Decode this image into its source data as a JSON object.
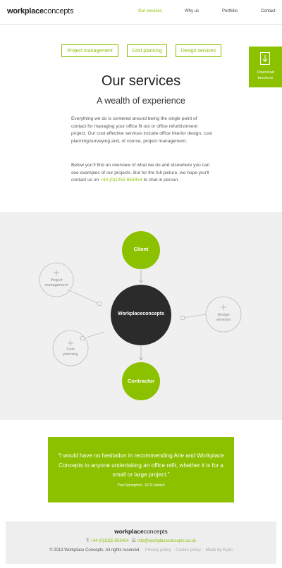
{
  "header": {
    "logo_bold": "workplace",
    "logo_light": "concepts",
    "nav": [
      {
        "label": "Our services",
        "active": true
      },
      {
        "label": "Why us",
        "active": false
      },
      {
        "label": "Portfolio",
        "active": false
      },
      {
        "label": "Contact",
        "active": false
      }
    ]
  },
  "tabs": [
    "Project management",
    "Cost planning",
    "Design services"
  ],
  "download": {
    "line1": "Download",
    "line2": "brochure",
    "icon": "download-arrow-icon"
  },
  "intro": {
    "title": "Our services",
    "subtitle": "A wealth of experience",
    "p1": "Everything we do is centered around being the single point of contact for managing your office fit out or office refurbishment project. Our cost effective services include office interior design, cost planning/surveying and, of course, project management.",
    "p2_before": "Below you'll find an overview of what we do and elsewhere you can see examples of our projects. But for the full picture, we hope you'll contact us on ",
    "p2_phone": "+44 (0)1252 653454",
    "p2_after": " to chat in person."
  },
  "diagram": {
    "center": "Workplaceconcepts",
    "client": "Client",
    "contractor": "Contractor",
    "project_line1": "Project",
    "project_line2": "management",
    "design_line1": "Design",
    "design_line2": "services",
    "cost_line1": "Cost",
    "cost_line2": "planning",
    "colors": {
      "green": "#8cc100",
      "dark": "#2b2b2b"
    }
  },
  "quote": {
    "text": "“I would have no hesitation in recommending Arie and Workplace Concepts to anyone undertaking an office refit, whether it is for a small or large project.”",
    "cite": "Paul Springford - RCS Limited"
  },
  "footer": {
    "logo_bold": "workplace",
    "logo_light": "concepts",
    "tel_label": "T:",
    "tel": "+44 (0)1252 653454",
    "email_label": "E:",
    "email": "info@workplaceconcepts.co.uk",
    "copyright": "© 2013 Workplace Concepts. All rights reserved.",
    "privacy": "Privacy policy",
    "cookie": "Cookie policy",
    "made": "Made by Kyan"
  },
  "accent_color": "#8cc100"
}
